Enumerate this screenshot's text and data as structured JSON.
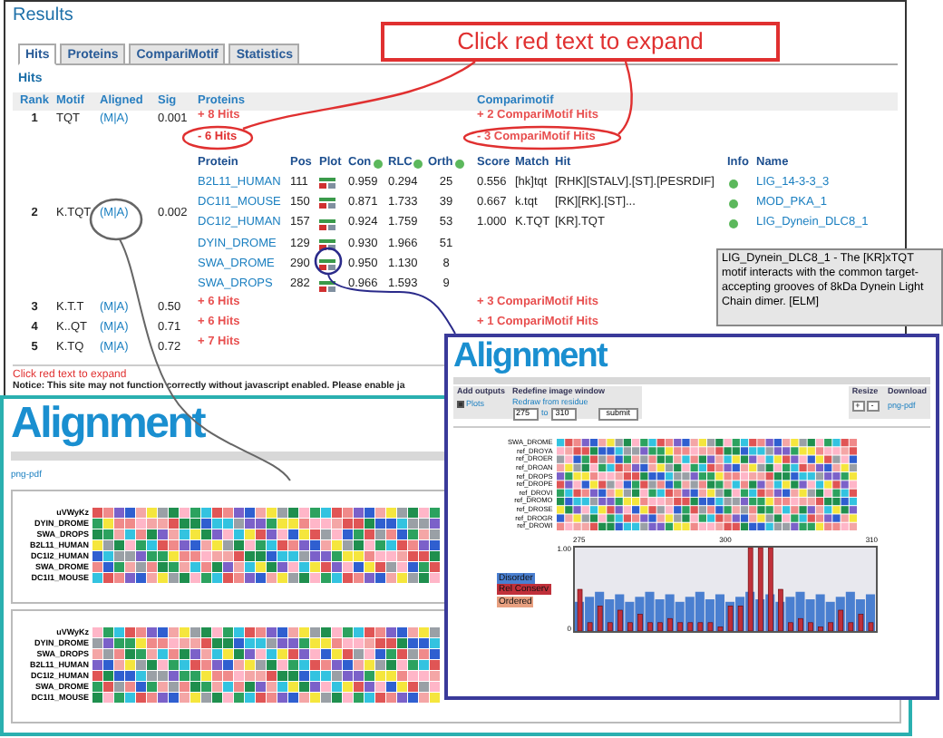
{
  "results": {
    "title": "Results",
    "tabs": [
      {
        "label": "Hits",
        "selected": true
      },
      {
        "label": "Proteins",
        "selected": false
      },
      {
        "label": "CompariMotif",
        "selected": false
      },
      {
        "label": "Statistics",
        "selected": false
      }
    ],
    "section": "Hits",
    "columns": [
      "Rank",
      "Motif",
      "Aligned",
      "Sig",
      "Proteins",
      "Comparimotif"
    ],
    "rows": [
      {
        "rank": "1",
        "motif": "TQT",
        "aligned": "(M|A)",
        "sig": "0.001",
        "proteins": "+ 8 Hits",
        "comparimotif": "+ 2 CompariMotif Hits",
        "expanded": false
      },
      {
        "rank": "2",
        "motif": "K.TQT",
        "aligned": "(M|A)",
        "sig": "0.002",
        "proteins": "- 6 Hits",
        "comparimotif": "- 3 CompariMotif Hits",
        "expanded": true,
        "protein_table": {
          "columns": [
            "Protein",
            "Pos",
            "Plot",
            "Con",
            "RLC",
            "Orth"
          ],
          "rows": [
            [
              "B2L11_HUMAN",
              "111",
              "",
              "0.959",
              "0.294",
              "25"
            ],
            [
              "DC1I1_MOUSE",
              "150",
              "",
              "0.871",
              "1.733",
              "39"
            ],
            [
              "DC1I2_HUMAN",
              "157",
              "",
              "0.924",
              "1.759",
              "53"
            ],
            [
              "DYIN_DROME",
              "129",
              "",
              "0.930",
              "1.966",
              "51"
            ],
            [
              "SWA_DROME",
              "290",
              "",
              "0.950",
              "1.130",
              "8"
            ],
            [
              "SWA_DROPS",
              "282",
              "",
              "0.966",
              "1.593",
              "9"
            ]
          ]
        },
        "compari_table": {
          "columns": [
            "Score",
            "Match",
            "Hit",
            "Info",
            "Name"
          ],
          "rows": [
            [
              "0.556",
              "[hk]tqt",
              "[RHK][STALV].[ST].[PESRDIF]",
              "",
              "LIG_14-3-3_3"
            ],
            [
              "0.667",
              "k.tqt",
              "[RK][RK].[ST]...",
              "",
              "MOD_PKA_1"
            ],
            [
              "1.000",
              "K.TQT",
              "[KR].TQT",
              "",
              "LIG_Dynein_DLC8_1"
            ]
          ]
        }
      },
      {
        "rank": "3",
        "motif": "K.T.T",
        "aligned": "(M|A)",
        "sig": "0.50",
        "proteins": "+ 6 Hits",
        "comparimotif": "+ 3 CompariMotif Hits",
        "expanded": false
      },
      {
        "rank": "4",
        "motif": "K..QT",
        "aligned": "(M|A)",
        "sig": "0.71",
        "proteins": "+ 6 Hits",
        "comparimotif": "+ 1 CompariMotif Hits",
        "expanded": false
      },
      {
        "rank": "5",
        "motif": "K.TQ",
        "aligned": "(M|A)",
        "sig": "0.72",
        "proteins": "+ 7 Hits",
        "expanded": false
      }
    ],
    "hint": "Click red text to expand",
    "notice": "Notice: This site may not function correctly without javascript enabled. Please enable ja"
  },
  "callout": {
    "text": "Click red text to expand"
  },
  "tooltip": {
    "text": "LIG_Dynein_DLC8_1 - The [KR]xTQT motif interacts with the common target-accepting grooves of 8kDa Dynein Light Chain dimer. [ELM]"
  },
  "alignment_back": {
    "title": "Alignment",
    "download": "png-pdf",
    "panels": [
      {
        "names": [
          "uVWyKz",
          "DYIN_DROME",
          "SWA_DROPS",
          "B2L11_HUMAN",
          "DC1I2_HUMAN",
          "SWA_DROME",
          "DC1I1_MOUSE"
        ]
      },
      {
        "names": [
          "uVWyKz",
          "DYIN_DROME",
          "SWA_DROPS",
          "B2L11_HUMAN",
          "DC1I2_HUMAN",
          "SWA_DROME",
          "DC1I1_MOUSE"
        ]
      }
    ]
  },
  "alignment_front": {
    "title": "Alignment",
    "outputs_label": "Add outputs",
    "outputs": [
      {
        "label": "Plots",
        "checked": true
      }
    ],
    "redefine_label": "Redefine image window",
    "redraw_label": "Redraw from residue",
    "from": "275",
    "to_label": "to",
    "to": "310",
    "submit": "submit",
    "resize_label": "Resize",
    "resize_buttons": [
      "+",
      "-"
    ],
    "download_label": "Download",
    "download": "png-pdf",
    "names": [
      "SWA_DROME",
      "ref_DROYA",
      "ref_DROER",
      "ref_DROAN",
      "ref_DROPS",
      "ref_DROPE",
      "ref_DROVI",
      "ref_DROMO",
      "ref_DROSE",
      "ref_DROGR",
      "ref_DROWI"
    ],
    "axis_labels": [
      "275",
      "300",
      "310"
    ],
    "y_labels": [
      "1.00",
      "0"
    ],
    "legend": [
      {
        "label": "Disorder",
        "color": "#4a7fd0"
      },
      {
        "label": "Rel Conserv",
        "color": "#c0303a"
      },
      {
        "label": "Ordered",
        "color": "#e8a080"
      }
    ]
  }
}
